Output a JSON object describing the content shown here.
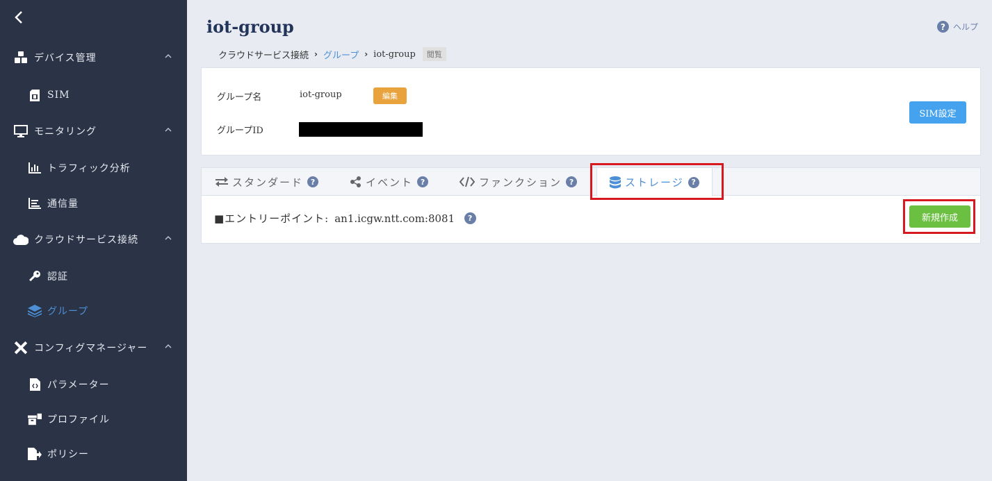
{
  "sidebar": {
    "back_icon": "chevron-left-icon",
    "items": [
      {
        "label": "デバイス管理",
        "icon": "cubes-icon"
      },
      {
        "label": "SIM",
        "icon": "sim-card-icon"
      },
      {
        "label": "モニタリング",
        "icon": "monitor-icon"
      },
      {
        "label": "トラフィック分析",
        "icon": "bar-chart-icon"
      },
      {
        "label": "通信量",
        "icon": "line-chart-icon"
      },
      {
        "label": "クラウドサービス接続",
        "icon": "cloud-icon"
      },
      {
        "label": "認証",
        "icon": "key-icon"
      },
      {
        "label": "グループ",
        "icon": "layers-icon"
      },
      {
        "label": "コンフィグマネージャー",
        "icon": "tools-icon"
      },
      {
        "label": "パラメーター",
        "icon": "code-file-icon"
      },
      {
        "label": "プロファイル",
        "icon": "archive-icon"
      },
      {
        "label": "ポリシー",
        "icon": "file-export-icon"
      }
    ]
  },
  "header": {
    "title": "iot-group",
    "help_label": "ヘルプ"
  },
  "breadcrumb": {
    "root": "クラウドサービス接続",
    "parent": "グループ",
    "current": "iot-group",
    "mode_tag": "閲覧"
  },
  "group_card": {
    "name_label": "グループ名",
    "name_value": "iot-group",
    "edit_label": "編集",
    "id_label": "グループID",
    "sim_button": "SIM設定"
  },
  "tabs": [
    {
      "label": "スタンダード",
      "icon": "exchange-icon"
    },
    {
      "label": "イベント",
      "icon": "share-icon"
    },
    {
      "label": "ファンクション",
      "icon": "code-icon"
    },
    {
      "label": "ストレージ",
      "icon": "database-icon"
    }
  ],
  "storage": {
    "entry_label": "■エントリーポイント:",
    "entry_value": "an1.icgw.ntt.com:8081",
    "new_button": "新規作成"
  },
  "colors": {
    "sidebar_bg": "#2b3447",
    "accent": "#4d8fd6",
    "edit": "#e8a33d",
    "sim_button": "#44a2ee",
    "new_button": "#6cc041",
    "highlight": "#d8181f"
  }
}
